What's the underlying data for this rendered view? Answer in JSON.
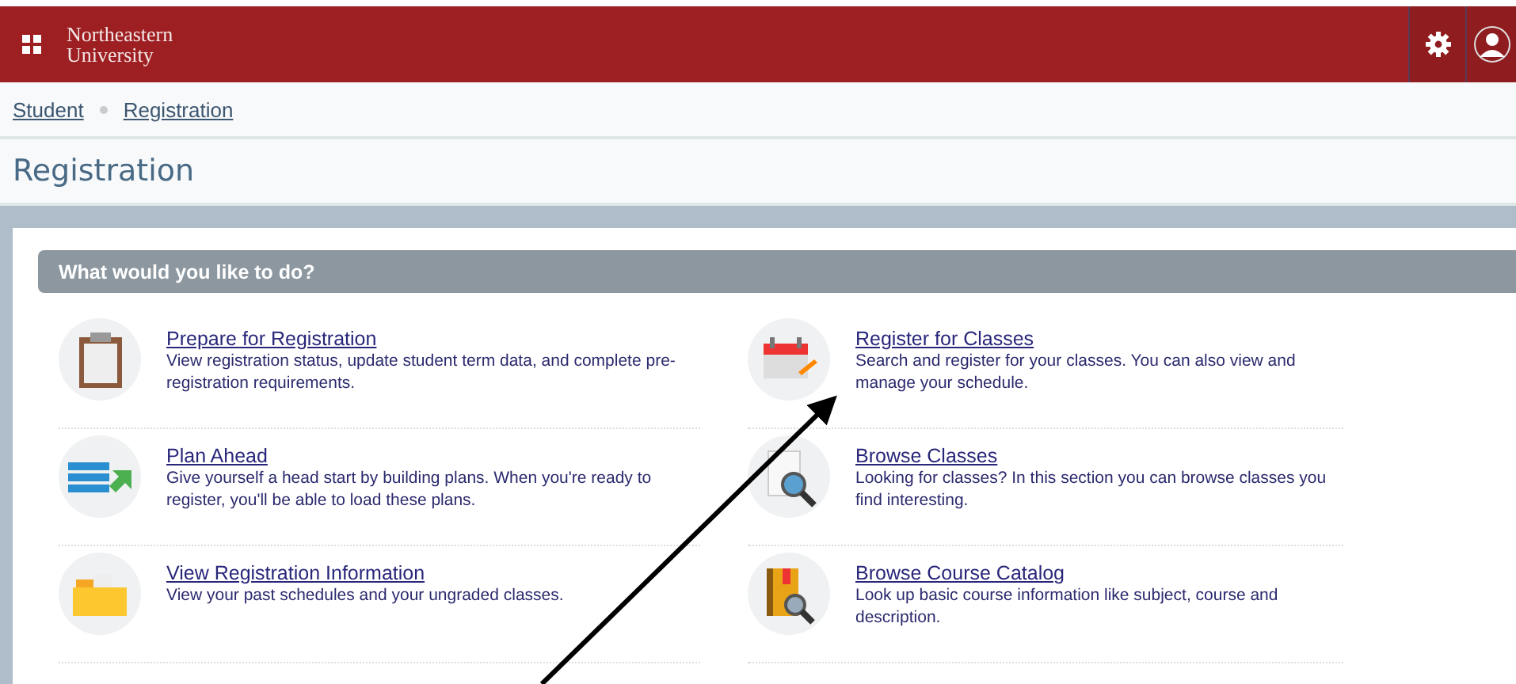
{
  "header": {
    "logo_line_1": "Northeastern",
    "logo_line_2": "University"
  },
  "breadcrumb": [
    "Student",
    "Registration"
  ],
  "page_title": "Registration",
  "panel": {
    "heading": "What would you like to do?",
    "items": [
      {
        "kind": "clipboard",
        "title": "Prepare for Registration",
        "description": "View registration status, update student term data, and complete pre-registration requirements."
      },
      {
        "kind": "calendar",
        "title": "Register for Classes",
        "description": "Search and register for your classes. You can also view and manage your schedule."
      },
      {
        "kind": "plan",
        "title": "Plan Ahead",
        "description": "Give yourself a head start by building plans. When you're ready to register, you'll be able to load these plans."
      },
      {
        "kind": "search",
        "title": "Browse Classes",
        "description": "Looking for classes? In this section you can browse classes you find interesting."
      },
      {
        "kind": "folder",
        "title": "View Registration Information",
        "description": "View your past schedules and your ungraded classes."
      },
      {
        "kind": "catalog",
        "title": "Browse Course Catalog",
        "description": "Look up basic course information like subject, course and description."
      }
    ]
  }
}
